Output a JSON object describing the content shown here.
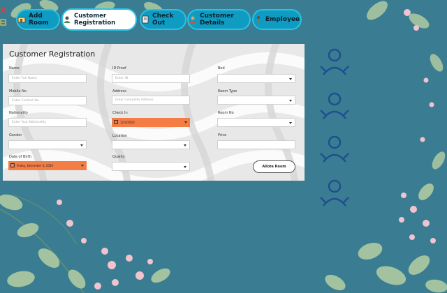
{
  "tabs": [
    {
      "label": "Add Room",
      "icon": "room-icon"
    },
    {
      "label": "Customer Registration",
      "icon": "customer-icon",
      "active": true
    },
    {
      "label": "Check Out",
      "icon": "checkout-icon"
    },
    {
      "label": "Customer Details",
      "icon": "details-icon"
    },
    {
      "label": "Employee",
      "icon": "employee-icon"
    }
  ],
  "form": {
    "title": "Customer Registration",
    "name": {
      "label": "Name",
      "placeholder": "Enter Full Name"
    },
    "mobile": {
      "label": "Mobile No",
      "placeholder": "Enter Contact No"
    },
    "nationality": {
      "label": "Nationality",
      "placeholder": "Enter Your Nationality"
    },
    "gender": {
      "label": "Gender"
    },
    "dob": {
      "label": "Date of Birth",
      "value": "Friday, December 4, 2020"
    },
    "idproof": {
      "label": "ID Proof",
      "placeholder": "Enter ID"
    },
    "address": {
      "label": "Address",
      "placeholder": "Enter Complete Address"
    },
    "checkin": {
      "label": "Check In",
      "value": "12/4/2020"
    },
    "location": {
      "label": "Location"
    },
    "quality": {
      "label": "Quality"
    },
    "bed": {
      "label": "Bed"
    },
    "roomtype": {
      "label": "Room Type"
    },
    "roomno": {
      "label": "Room No"
    },
    "price": {
      "label": "Price"
    },
    "allot": {
      "label": "Allote Room"
    }
  },
  "colors": {
    "background": "#3a7d92",
    "tab": "#0f9bc2",
    "date_field": "#f47c45",
    "avatar": "#1f4f8f"
  }
}
